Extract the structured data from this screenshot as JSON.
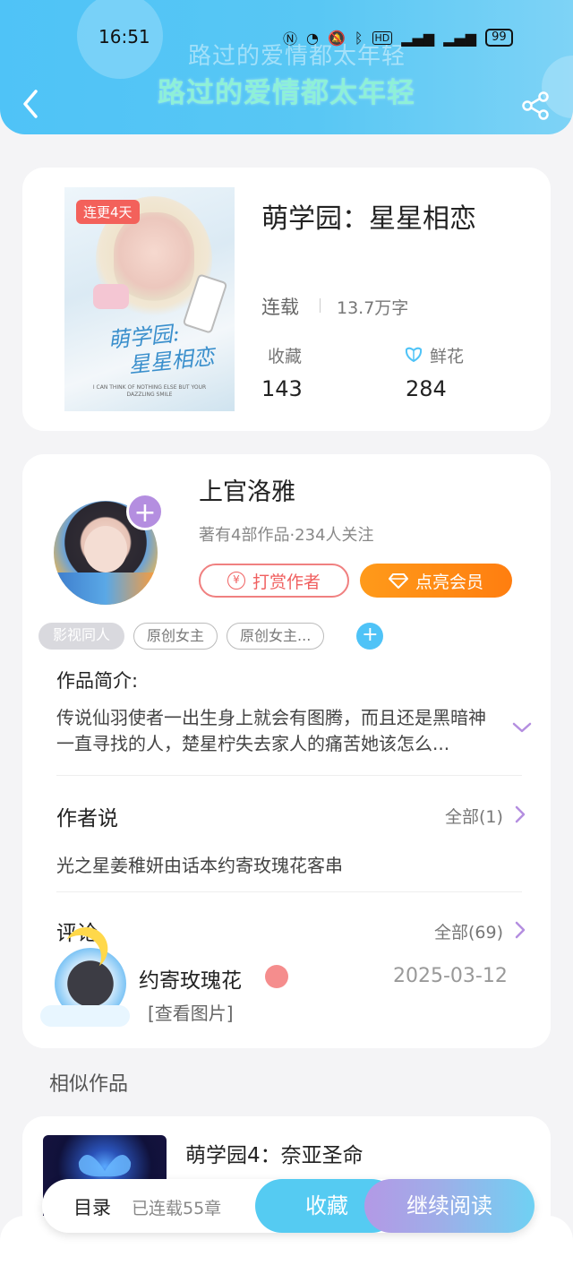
{
  "status_bar": {
    "time": "16:51",
    "overlay_title": "路过的爱情都太年轻",
    "battery": "99"
  },
  "header": {
    "title": "路过的爱情都太年轻"
  },
  "book": {
    "badge": "连更4天",
    "title": "萌学园：星星相恋",
    "status": "连载",
    "word_count": "13.7万字",
    "favorites_label": "收藏",
    "favorites": "143",
    "flowers_label": "鲜花",
    "flowers": "284",
    "cover_script_line1": "萌学园:",
    "cover_script_line2": "星星相恋",
    "cover_small_text": "I CAN THINK OF NOTHING ELSE BUT YOUR DAZZLING SMILE"
  },
  "author": {
    "name": "上官洛雅",
    "meta": "著有4部作品·234人关注",
    "tip_label": "打赏作者",
    "tip_icon": "¥",
    "vip_label": "点亮会员",
    "follow": "+"
  },
  "tags": [
    "影视同人",
    "原创女主",
    "原创女主..."
  ],
  "tag_add": "+",
  "synopsis": {
    "heading": "作品简介:",
    "text": "传说仙羽使者一出生身上就会有图腾，而且还是黑暗神一直寻找的人，楚星柠失去家人的痛苦她该怎么..."
  },
  "author_says": {
    "heading": "作者说",
    "all": "全部(1)",
    "text": "光之星姜稚妍由话本约寄玫瑰花客串"
  },
  "comments": {
    "heading": "评论",
    "all": "全部(69)",
    "user": "约寄玫瑰花",
    "date": "2025-03-12",
    "text": "[查看图片]"
  },
  "similar": {
    "heading": "相似作品",
    "title": "萌学园4：奈亚圣命"
  },
  "action_bar": {
    "toc": "目录",
    "chapters": "已连载55章",
    "favorite": "收藏",
    "continue": "继续阅读"
  },
  "colors": {
    "header": "#4fc3f7",
    "accent_orange": "#ff8c14",
    "accent_purple": "#b48ee0",
    "tip_red": "#f06060"
  },
  "icons": [
    "back-icon",
    "share-icon",
    "flower-icon",
    "yuan-icon",
    "diamond-icon",
    "plus-icon",
    "chevron-down-icon",
    "chevron-right-icon"
  ]
}
